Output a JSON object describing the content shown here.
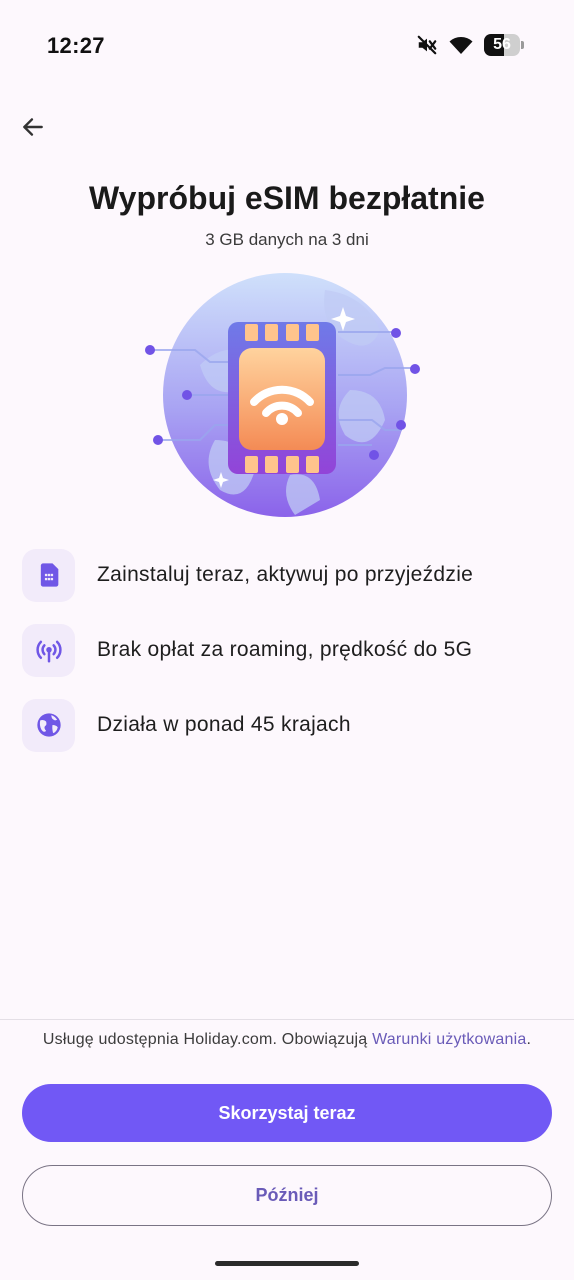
{
  "status_bar": {
    "time": "12:27",
    "battery_level": "56",
    "battery_fraction": 0.56,
    "icons": [
      "mute-icon",
      "wifi-icon",
      "battery-icon"
    ]
  },
  "header": {
    "back_icon": "arrow-left-icon",
    "title": "Wypróbuj eSIM bezpłatnie",
    "subtitle": "3 GB danych na 3 dni"
  },
  "illustration": {
    "icon": "esim-card-wifi-globe-icon"
  },
  "features": [
    {
      "icon": "sim-card-icon",
      "text": "Zainstaluj teraz, aktywuj po przyjeździe"
    },
    {
      "icon": "antenna-signal-icon",
      "text": "Brak opłat za roaming, prędkość do 5G"
    },
    {
      "icon": "globe-icon",
      "text": "Działa w ponad 45 krajach"
    }
  ],
  "footer": {
    "terms_prefix": "Usługę udostępnia Holiday.com. Obowiązują ",
    "terms_link": "Warunki użytkowania",
    "terms_suffix": ".",
    "primary_button": "Skorzystaj teraz",
    "secondary_button": "Później"
  },
  "colors": {
    "background": "#fdf8fd",
    "accent": "#7158f5",
    "link": "#6a5bb8",
    "icon_tile": "#f2ebfa"
  }
}
